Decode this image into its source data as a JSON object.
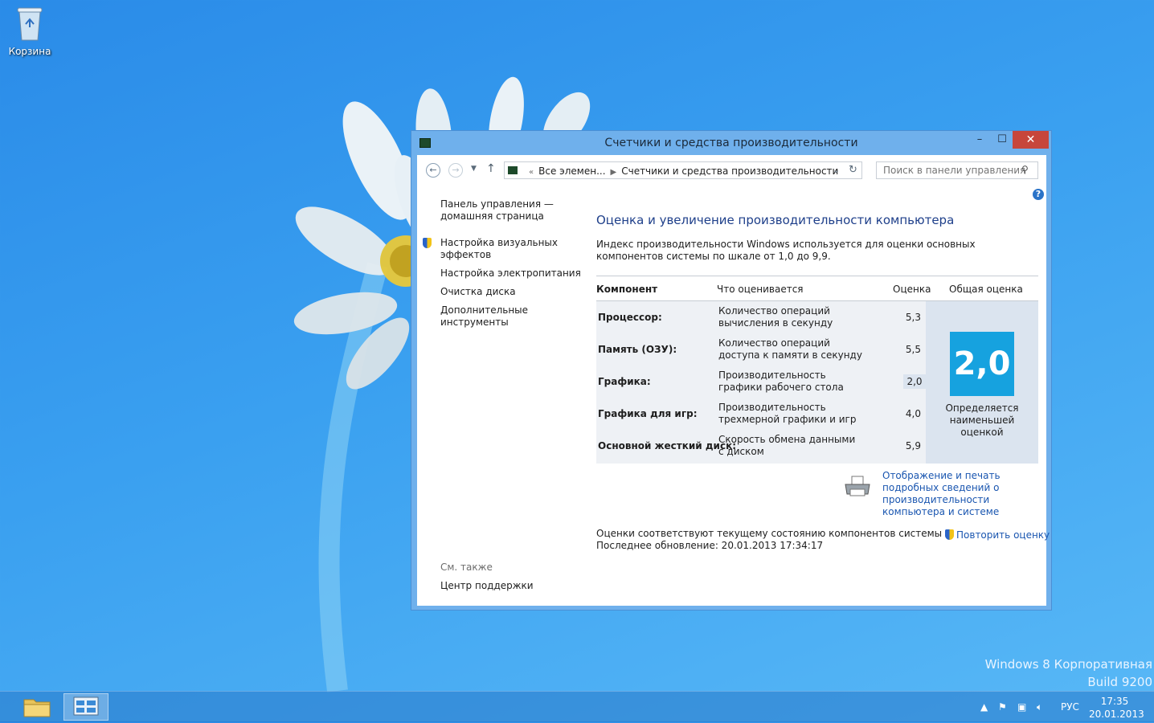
{
  "desktop": {
    "recycle_bin_label": "Корзина",
    "watermark_line1": "Windows 8 Корпоративная",
    "watermark_line2": "Build 9200"
  },
  "window": {
    "title": "Счетчики и средства производительности",
    "controls": {
      "minimize": "–",
      "maximize": "☐",
      "close": "✕"
    }
  },
  "nav": {
    "breadcrumb_root": "Все элемен...",
    "breadcrumb_current": "Счетчики и средства производительности",
    "search_placeholder": "Поиск в панели управления"
  },
  "sidebar": {
    "home_line1": "Панель управления —",
    "home_line2": "домашняя страница",
    "visual_effects_line1": "Настройка визуальных",
    "visual_effects_line2": "эффектов",
    "power": "Настройка электропитания",
    "disk_cleanup": "Очистка диска",
    "advanced_tools_line1": "Дополнительные",
    "advanced_tools_line2": "инструменты",
    "see_also": "См. также",
    "action_center": "Центр поддержки"
  },
  "main": {
    "heading": "Оценка и увеличение производительности компьютера",
    "intro": "Индекс производительности Windows используется для оценки основных компонентов системы по шкале от 1,0 до 9,9.",
    "table": {
      "col_component": "Компонент",
      "col_what": "Что оценивается",
      "col_score": "Оценка",
      "col_total": "Общая оценка",
      "rows": [
        {
          "component": "Процессор:",
          "what": "Количество операций вычисления в секунду",
          "score": "5,3"
        },
        {
          "component": "Память (ОЗУ):",
          "what": "Количество операций доступа к памяти в секунду",
          "score": "5,5"
        },
        {
          "component": "Графика:",
          "what": "Производительность графики рабочего стола",
          "score": "2,0"
        },
        {
          "component": "Графика для игр:",
          "what": "Производительность трехмерной графики и игр",
          "score": "4,0"
        },
        {
          "component": "Основной жесткий диск:",
          "what": "Скорость обмена данными с диском",
          "score": "5,9"
        }
      ],
      "base_score": "2,0",
      "base_caption": "Определяется наименьшей оценкой"
    },
    "print_link": "Отображение и печать подробных сведений о производительности компьютера и системе",
    "status_line1": "Оценки соответствуют текущему состоянию компонентов системы",
    "status_line2": "Последнее обновление: 20.01.2013 17:34:17",
    "rerun_link": "Повторить оценку"
  },
  "taskbar": {
    "language": "РУС",
    "time": "17:35",
    "date": "20.01.2013"
  },
  "colors": {
    "accent_tile": "#16a2df",
    "link": "#1a56b0",
    "heading": "#1e3f8a",
    "close_button": "#c7463b"
  }
}
